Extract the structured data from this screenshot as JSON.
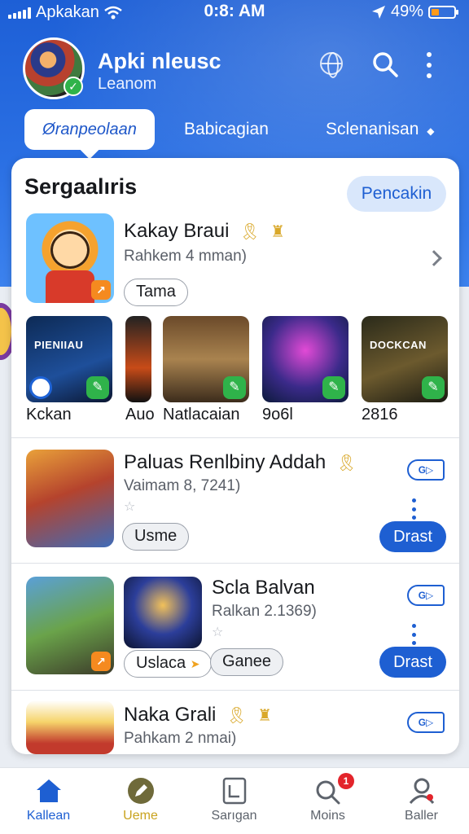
{
  "status_bar": {
    "carrier": "Apkakan",
    "time": "0:8: AM",
    "battery": "49%"
  },
  "header": {
    "title": "Apki nleusc",
    "subtitle": "Leanom"
  },
  "tabs": [
    {
      "label": "Øranpeolaan"
    },
    {
      "label": "Babicagian"
    },
    {
      "label": "Sclenanisan"
    }
  ],
  "section": {
    "title": "Sergaalıris",
    "action_label": "Pencakin"
  },
  "featured": {
    "title": "Kakay Braui",
    "subtitle": "Rahkem 4 mman)",
    "tag": "Tama"
  },
  "minis": [
    {
      "label": "Kckan",
      "art_text": "PIENIIAU"
    },
    {
      "label": "Auo",
      "art_text": ""
    },
    {
      "label": "Natlacaian",
      "art_text": ""
    },
    {
      "label": "9o6l",
      "art_text": ""
    },
    {
      "label": "2816",
      "art_text": "DOCKCAN"
    }
  ],
  "apps": [
    {
      "title": "Paluas Renlbiny Addah",
      "subtitle": "Vaimam 8, 7241)",
      "tag": "Usme",
      "button": "Drast",
      "chip": "G▷"
    },
    {
      "title": "Scla Balvan",
      "subtitle": "Ralkan 2.1369)",
      "tag": "Uslaca",
      "tag2": "Ganee",
      "button": "Drast",
      "chip": "G▷"
    },
    {
      "title": "Naka Grali",
      "subtitle": "Pahkam 2 nmai)",
      "chip": "G▷"
    }
  ],
  "bottom_nav": [
    {
      "label": "Kallean",
      "active": true
    },
    {
      "label": "Ueme"
    },
    {
      "label": "Sarıgan"
    },
    {
      "label": "Moins",
      "badge": "1"
    },
    {
      "label": "Baller"
    }
  ],
  "colors": {
    "primary": "#1e5fd2",
    "header_gradient_top": "#1d5fd6",
    "active_nav": "#1e5fd2",
    "success": "#2fb34a",
    "notification": "#e3242b"
  }
}
